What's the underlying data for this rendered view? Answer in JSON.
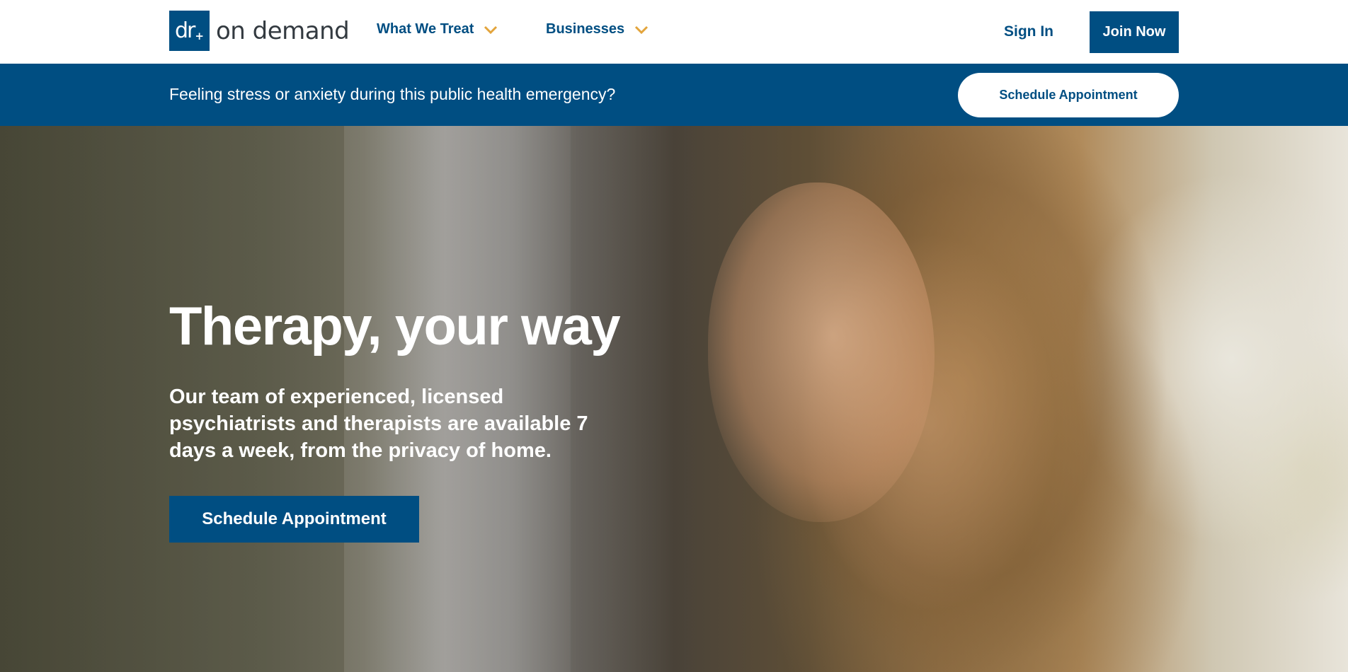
{
  "logo": {
    "mark": "dr",
    "mark_plus": "+",
    "text": "on demand"
  },
  "nav": {
    "items": [
      {
        "label": "What We Treat",
        "icon": "chevron-down-icon"
      },
      {
        "label": "Businesses",
        "icon": "chevron-down-icon"
      }
    ],
    "sign_in": "Sign In",
    "join_now": "Join Now"
  },
  "banner": {
    "text": "Feeling stress or anxiety during this public health emergency?",
    "button": "Schedule Appointment"
  },
  "hero": {
    "title": "Therapy, your way",
    "description": "Our team of experienced, licensed psychiatrists and therapists are available 7 days a week, from the privacy of home.",
    "button": "Schedule Appointment"
  },
  "colors": {
    "brand": "#004e82",
    "accent": "#e3a43b",
    "text_dark": "#333a40"
  }
}
